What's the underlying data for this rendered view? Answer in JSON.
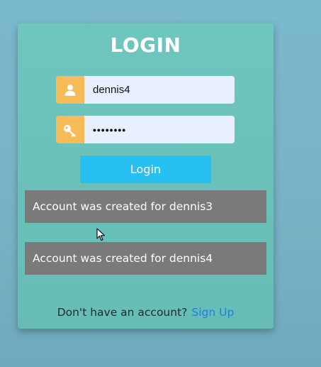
{
  "login": {
    "title": "LOGIN",
    "username": {
      "value": "dennis4"
    },
    "password": {
      "value": "••••••••"
    },
    "button_label": "Login",
    "messages": [
      "Account was created for dennis3",
      "Account was created for dennis4"
    ],
    "footer": {
      "prompt": "Don't have an account?",
      "signup_link": "Sign Up"
    }
  },
  "icons": [
    "user-icon",
    "key-icon",
    "mouse-cursor-icon"
  ],
  "colors": {
    "page_background": "#7ab8ce",
    "card_background": "#6ec6bf",
    "icon_box": "#f7bb57",
    "input_background": "#e8effe",
    "button": "#28c0f1",
    "message_background": "#7a7a7a",
    "link": "#1f7fd8"
  }
}
